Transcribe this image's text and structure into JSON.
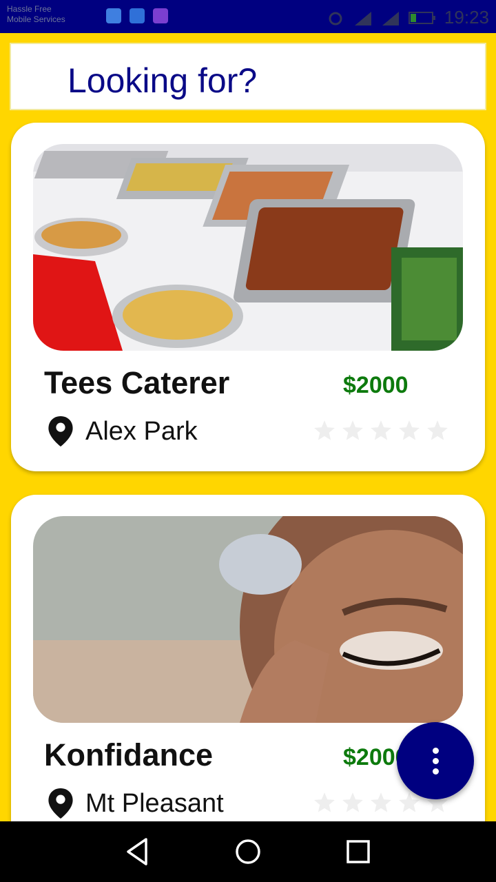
{
  "status_bar": {
    "left_text_line1": "Hassle Free",
    "left_text_line2": "Mobile Services",
    "time": "19:23",
    "icons": [
      "sync-icon",
      "usb-icon",
      "photo-icon",
      "alarm-icon",
      "signal-icon",
      "battery-icon"
    ]
  },
  "search": {
    "placeholder": "Looking for?"
  },
  "listings": [
    {
      "title": "Tees Caterer",
      "price": "$2000",
      "location": "Alex Park",
      "rating": 0,
      "image": "catering-buffet-image"
    },
    {
      "title": "Konfidance",
      "price": "$2000",
      "location": "Mt Pleasant",
      "rating": 0,
      "image": "makeup-artist-image"
    }
  ],
  "colors": {
    "background": "#ffd600",
    "primary": "#000080",
    "price": "#0d7a0d",
    "star_empty": "#eeeeee"
  },
  "fab": {
    "icon": "more-vertical-icon"
  },
  "nav": {
    "back": "back-icon",
    "home": "home-icon",
    "recents": "recents-icon"
  }
}
